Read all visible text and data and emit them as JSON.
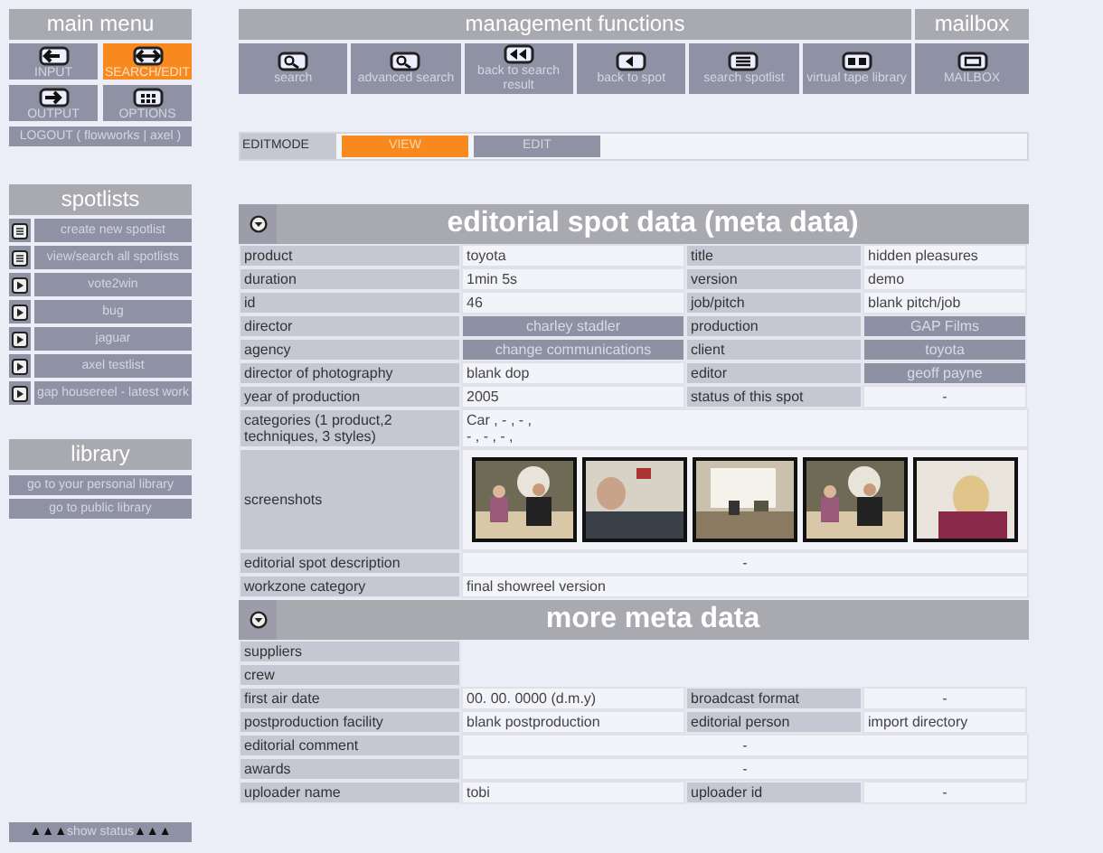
{
  "main_menu": {
    "title": "main menu",
    "buttons": [
      {
        "label": "INPUT",
        "kind": "in",
        "selected": false
      },
      {
        "label": "SEARCH/EDIT",
        "kind": "both",
        "selected": true
      },
      {
        "label": "OUTPUT",
        "kind": "out",
        "selected": false
      },
      {
        "label": "OPTIONS",
        "kind": "grid",
        "selected": false
      }
    ],
    "logout": "LOGOUT ( flowworks | axel )"
  },
  "spotlists": {
    "title": "spotlists",
    "items": [
      {
        "label": "create new spotlist",
        "kind": "list"
      },
      {
        "label": "view/search all spotlists",
        "kind": "list"
      },
      {
        "label": "vote2win",
        "kind": "play"
      },
      {
        "label": "bug",
        "kind": "play"
      },
      {
        "label": "jaguar",
        "kind": "play"
      },
      {
        "label": "axel testlist",
        "kind": "play"
      },
      {
        "label": "gap housereel - latest work",
        "kind": "play"
      }
    ]
  },
  "library": {
    "title": "library",
    "items": [
      "go to your personal library",
      "go to public library"
    ]
  },
  "status_toggle": {
    "arrows": "▲▲▲",
    "label": "show status"
  },
  "management": {
    "title": "management functions",
    "buttons": [
      {
        "label": "search",
        "kind": "search"
      },
      {
        "label": "advanced search",
        "kind": "search"
      },
      {
        "label": "back to search result",
        "kind": "rewind"
      },
      {
        "label": "back to spot",
        "kind": "back"
      },
      {
        "label": "search spotlist",
        "kind": "lines"
      },
      {
        "label": "virtual tape library",
        "kind": "tape"
      }
    ]
  },
  "mailbox": {
    "title": "mailbox",
    "button": {
      "label": "MAILBOX",
      "kind": "mail"
    }
  },
  "editmode": {
    "label": "EDITMODE",
    "options": [
      {
        "label": "VIEW",
        "selected": true
      },
      {
        "label": "EDIT",
        "selected": false
      }
    ]
  },
  "sections": [
    {
      "title": "editorial spot data (meta data)",
      "rows": [
        {
          "kind": "pair",
          "cells": [
            {
              "text": "product"
            },
            {
              "text": "toyota",
              "kind": "text"
            },
            {
              "text": "title"
            },
            {
              "text": "hidden pleasures",
              "kind": "text"
            }
          ]
        },
        {
          "kind": "pair",
          "cells": [
            {
              "text": "duration"
            },
            {
              "text": "1min 5s",
              "kind": "text"
            },
            {
              "text": "version"
            },
            {
              "text": "demo",
              "kind": "text"
            }
          ]
        },
        {
          "kind": "pair",
          "cells": [
            {
              "text": "id"
            },
            {
              "text": "46",
              "kind": "text"
            },
            {
              "text": "job/pitch"
            },
            {
              "text": "blank pitch/job",
              "kind": "text"
            }
          ]
        },
        {
          "kind": "pair",
          "cells": [
            {
              "text": "director"
            },
            {
              "text": "charley stadler",
              "kind": "link"
            },
            {
              "text": "production"
            },
            {
              "text": "GAP Films",
              "kind": "link"
            }
          ]
        },
        {
          "kind": "pair",
          "cells": [
            {
              "text": "agency"
            },
            {
              "text": "change communications",
              "kind": "link"
            },
            {
              "text": "client"
            },
            {
              "text": "toyota",
              "kind": "link"
            }
          ]
        },
        {
          "kind": "pair",
          "cells": [
            {
              "text": "director of photography"
            },
            {
              "text": "blank dop",
              "kind": "text"
            },
            {
              "text": "editor"
            },
            {
              "text": "geoff payne",
              "kind": "link"
            }
          ]
        },
        {
          "kind": "pair",
          "cells": [
            {
              "text": "year of production"
            },
            {
              "text": "2005",
              "kind": "text"
            },
            {
              "text": "status of this spot"
            },
            {
              "text": "-",
              "kind": "center"
            }
          ]
        },
        {
          "kind": "lines",
          "label": "categories (1 product,2 techniques, 3 styles)",
          "lines": [
            "Car , - , - ,",
            "- , - , - ,"
          ]
        },
        {
          "kind": "pictures",
          "label": "screenshots"
        },
        {
          "kind": "wide",
          "label": "editorial spot description",
          "value": {
            "text": "-",
            "kind": "center"
          }
        },
        {
          "kind": "wide",
          "label": "workzone category",
          "value": {
            "text": "final showreel version",
            "kind": "text"
          }
        }
      ]
    },
    {
      "title": "more meta data",
      "rows": [
        {
          "kind": "label_only",
          "label": "suppliers"
        },
        {
          "kind": "label_only",
          "label": "crew"
        },
        {
          "kind": "pair",
          "cells": [
            {
              "text": "first air date"
            },
            {
              "text": "00. 00. 0000 (d.m.y)",
              "kind": "text"
            },
            {
              "text": "broadcast format"
            },
            {
              "text": "-",
              "kind": "center"
            }
          ]
        },
        {
          "kind": "pair",
          "cells": [
            {
              "text": "postproduction facility"
            },
            {
              "text": "blank postproduction",
              "kind": "text"
            },
            {
              "text": "editorial person"
            },
            {
              "text": "import directory",
              "kind": "text"
            }
          ]
        },
        {
          "kind": "wide",
          "label": "editorial comment",
          "value": {
            "text": "-",
            "kind": "center"
          }
        },
        {
          "kind": "wide",
          "label": "awards",
          "value": {
            "text": "-",
            "kind": "center"
          }
        },
        {
          "kind": "pair",
          "cells": [
            {
              "text": "uploader name"
            },
            {
              "text": "tobi",
              "kind": "text"
            },
            {
              "text": "uploader id"
            },
            {
              "text": "-",
              "kind": "center"
            }
          ]
        }
      ]
    }
  ]
}
